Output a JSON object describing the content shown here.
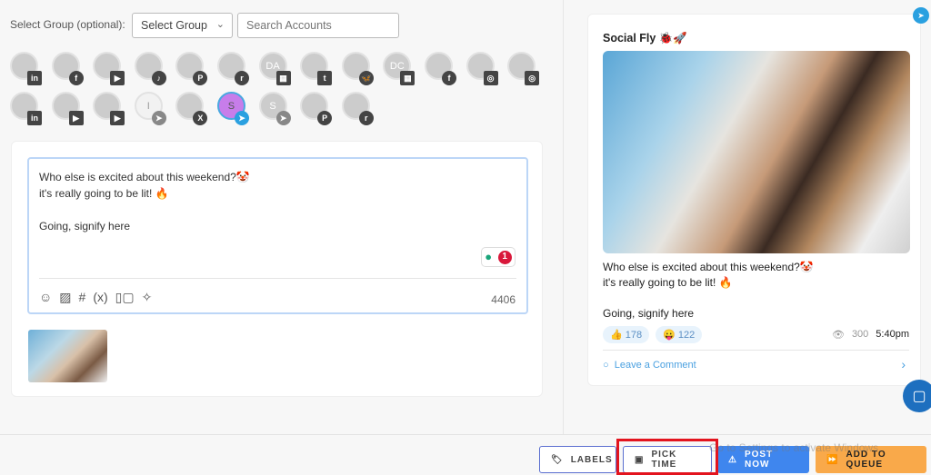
{
  "header": {
    "group_label": "Select Group (optional):",
    "group_select": "Select Group",
    "search_placeholder": "Search Accounts"
  },
  "accounts": [
    [
      {
        "i": "",
        "n": "in",
        "c": "linkedin"
      },
      {
        "i": "",
        "n": "f",
        "c": "facebook"
      },
      {
        "i": "",
        "n": "▶",
        "c": "youtube"
      },
      {
        "i": "",
        "n": "♪",
        "c": "tiktok"
      },
      {
        "i": "",
        "n": "P",
        "c": "pinterest"
      },
      {
        "i": "",
        "n": "r",
        "c": "reddit"
      },
      {
        "i": "DA",
        "n": "▦",
        "c": "google-business"
      },
      {
        "i": "",
        "n": "t",
        "c": "tumblr"
      },
      {
        "i": "",
        "n": "🦋",
        "c": "bluesky"
      },
      {
        "i": "DC",
        "n": "▦",
        "c": "google-business"
      },
      {
        "i": "",
        "n": "f",
        "c": "facebook"
      },
      {
        "i": "",
        "n": "◎",
        "c": "instagram"
      },
      {
        "i": "",
        "n": "◎",
        "c": "instagram"
      }
    ],
    [
      {
        "i": "",
        "n": "in",
        "c": "linkedin"
      },
      {
        "i": "",
        "n": "▶",
        "c": "youtube"
      },
      {
        "i": "",
        "n": "▶",
        "c": "youtube"
      },
      {
        "i": "I",
        "n": "➤",
        "c": "telegram"
      },
      {
        "i": "",
        "n": "X",
        "c": "x"
      },
      {
        "i": "S",
        "n": "➤",
        "c": "telegram",
        "selected": true
      },
      {
        "i": "S",
        "n": "➤",
        "c": "telegram"
      },
      {
        "i": "",
        "n": "P",
        "c": "pinterest"
      },
      {
        "i": "",
        "n": "r",
        "c": "reddit"
      }
    ]
  ],
  "editor": {
    "lines": [
      "Who else is excited about this weekend?🤡",
      "it's really going to be lit! 🔥",
      "",
      "Going, signify here"
    ],
    "hint_count": "1",
    "char_count": "4406",
    "tools": [
      "emoji-icon",
      "image-icon",
      "hashtag-icon",
      "variable-icon",
      "media-library-icon",
      "ai-sparkle-icon"
    ]
  },
  "preview": {
    "account_name": "Social Fly 🐞🚀",
    "lines": [
      "Who else is excited about this weekend?🤡",
      "it's really going to be lit! 🔥",
      "",
      "Going, signify here"
    ],
    "likes": "178",
    "reacts": "122",
    "views": "300",
    "time": "5:40pm",
    "comment": "Leave a Comment"
  },
  "actions": {
    "labels": "LABELS",
    "pick_time": "PICK TIME",
    "post_now": "POST NOW",
    "add_queue": "ADD TO QUEUE"
  },
  "watermark": "Go to Settings to activate Windows.",
  "colors": {
    "primary": "#3f86ee",
    "queue": "#f9a94a",
    "highlight": "#e3141e"
  }
}
